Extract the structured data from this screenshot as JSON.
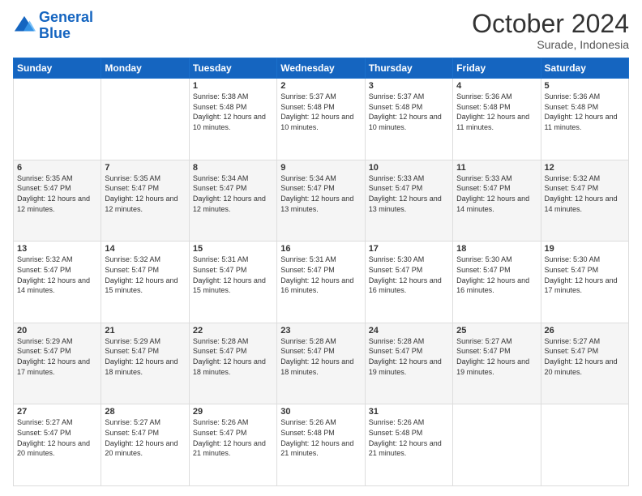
{
  "header": {
    "logo_line1": "General",
    "logo_line2": "Blue",
    "month": "October 2024",
    "location": "Surade, Indonesia"
  },
  "days_of_week": [
    "Sunday",
    "Monday",
    "Tuesday",
    "Wednesday",
    "Thursday",
    "Friday",
    "Saturday"
  ],
  "weeks": [
    [
      {
        "day": "",
        "info": ""
      },
      {
        "day": "",
        "info": ""
      },
      {
        "day": "1",
        "info": "Sunrise: 5:38 AM\nSunset: 5:48 PM\nDaylight: 12 hours and 10 minutes."
      },
      {
        "day": "2",
        "info": "Sunrise: 5:37 AM\nSunset: 5:48 PM\nDaylight: 12 hours and 10 minutes."
      },
      {
        "day": "3",
        "info": "Sunrise: 5:37 AM\nSunset: 5:48 PM\nDaylight: 12 hours and 10 minutes."
      },
      {
        "day": "4",
        "info": "Sunrise: 5:36 AM\nSunset: 5:48 PM\nDaylight: 12 hours and 11 minutes."
      },
      {
        "day": "5",
        "info": "Sunrise: 5:36 AM\nSunset: 5:48 PM\nDaylight: 12 hours and 11 minutes."
      }
    ],
    [
      {
        "day": "6",
        "info": "Sunrise: 5:35 AM\nSunset: 5:47 PM\nDaylight: 12 hours and 12 minutes."
      },
      {
        "day": "7",
        "info": "Sunrise: 5:35 AM\nSunset: 5:47 PM\nDaylight: 12 hours and 12 minutes."
      },
      {
        "day": "8",
        "info": "Sunrise: 5:34 AM\nSunset: 5:47 PM\nDaylight: 12 hours and 12 minutes."
      },
      {
        "day": "9",
        "info": "Sunrise: 5:34 AM\nSunset: 5:47 PM\nDaylight: 12 hours and 13 minutes."
      },
      {
        "day": "10",
        "info": "Sunrise: 5:33 AM\nSunset: 5:47 PM\nDaylight: 12 hours and 13 minutes."
      },
      {
        "day": "11",
        "info": "Sunrise: 5:33 AM\nSunset: 5:47 PM\nDaylight: 12 hours and 14 minutes."
      },
      {
        "day": "12",
        "info": "Sunrise: 5:32 AM\nSunset: 5:47 PM\nDaylight: 12 hours and 14 minutes."
      }
    ],
    [
      {
        "day": "13",
        "info": "Sunrise: 5:32 AM\nSunset: 5:47 PM\nDaylight: 12 hours and 14 minutes."
      },
      {
        "day": "14",
        "info": "Sunrise: 5:32 AM\nSunset: 5:47 PM\nDaylight: 12 hours and 15 minutes."
      },
      {
        "day": "15",
        "info": "Sunrise: 5:31 AM\nSunset: 5:47 PM\nDaylight: 12 hours and 15 minutes."
      },
      {
        "day": "16",
        "info": "Sunrise: 5:31 AM\nSunset: 5:47 PM\nDaylight: 12 hours and 16 minutes."
      },
      {
        "day": "17",
        "info": "Sunrise: 5:30 AM\nSunset: 5:47 PM\nDaylight: 12 hours and 16 minutes."
      },
      {
        "day": "18",
        "info": "Sunrise: 5:30 AM\nSunset: 5:47 PM\nDaylight: 12 hours and 16 minutes."
      },
      {
        "day": "19",
        "info": "Sunrise: 5:30 AM\nSunset: 5:47 PM\nDaylight: 12 hours and 17 minutes."
      }
    ],
    [
      {
        "day": "20",
        "info": "Sunrise: 5:29 AM\nSunset: 5:47 PM\nDaylight: 12 hours and 17 minutes."
      },
      {
        "day": "21",
        "info": "Sunrise: 5:29 AM\nSunset: 5:47 PM\nDaylight: 12 hours and 18 minutes."
      },
      {
        "day": "22",
        "info": "Sunrise: 5:28 AM\nSunset: 5:47 PM\nDaylight: 12 hours and 18 minutes."
      },
      {
        "day": "23",
        "info": "Sunrise: 5:28 AM\nSunset: 5:47 PM\nDaylight: 12 hours and 18 minutes."
      },
      {
        "day": "24",
        "info": "Sunrise: 5:28 AM\nSunset: 5:47 PM\nDaylight: 12 hours and 19 minutes."
      },
      {
        "day": "25",
        "info": "Sunrise: 5:27 AM\nSunset: 5:47 PM\nDaylight: 12 hours and 19 minutes."
      },
      {
        "day": "26",
        "info": "Sunrise: 5:27 AM\nSunset: 5:47 PM\nDaylight: 12 hours and 20 minutes."
      }
    ],
    [
      {
        "day": "27",
        "info": "Sunrise: 5:27 AM\nSunset: 5:47 PM\nDaylight: 12 hours and 20 minutes."
      },
      {
        "day": "28",
        "info": "Sunrise: 5:27 AM\nSunset: 5:47 PM\nDaylight: 12 hours and 20 minutes."
      },
      {
        "day": "29",
        "info": "Sunrise: 5:26 AM\nSunset: 5:47 PM\nDaylight: 12 hours and 21 minutes."
      },
      {
        "day": "30",
        "info": "Sunrise: 5:26 AM\nSunset: 5:48 PM\nDaylight: 12 hours and 21 minutes."
      },
      {
        "day": "31",
        "info": "Sunrise: 5:26 AM\nSunset: 5:48 PM\nDaylight: 12 hours and 21 minutes."
      },
      {
        "day": "",
        "info": ""
      },
      {
        "day": "",
        "info": ""
      }
    ]
  ]
}
